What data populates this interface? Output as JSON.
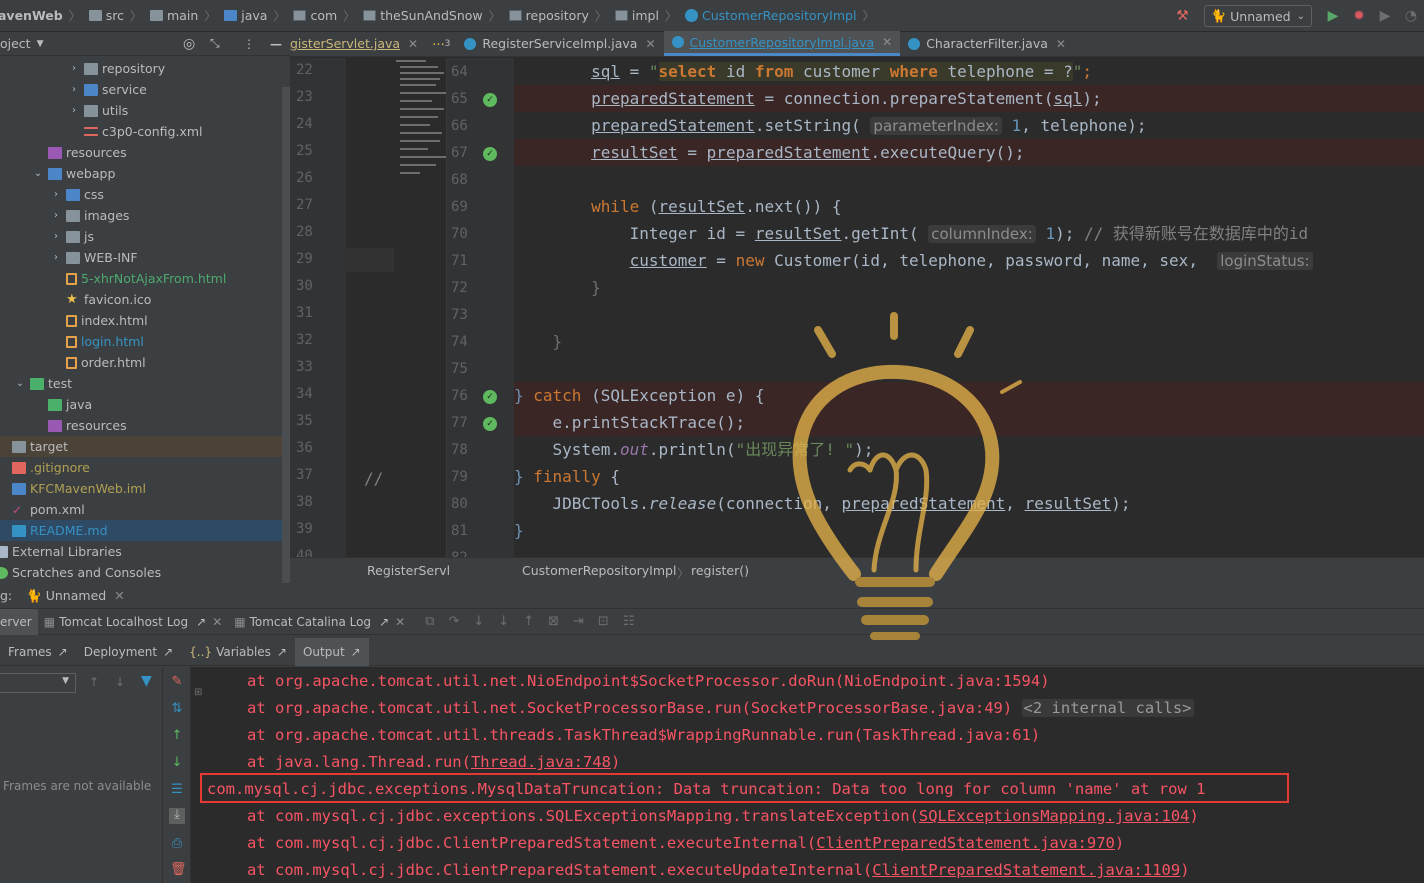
{
  "navbar": {
    "crumbs": [
      "avenWeb",
      "src",
      "main",
      "java",
      "com",
      "theSunAndSnow",
      "repository",
      "impl",
      "CustomerRepositoryImpl"
    ],
    "run_config": "Unnamed"
  },
  "project": {
    "header": "oject",
    "items": [
      {
        "label": "repository",
        "icon": "folder-icon"
      },
      {
        "label": "service",
        "icon": "folder-icon"
      },
      {
        "label": "utils",
        "icon": "folder-icon"
      },
      {
        "label": "c3p0-config.xml",
        "icon": "xml-file-icon"
      },
      {
        "label": "resources",
        "icon": "resources-folder-icon"
      },
      {
        "label": "webapp",
        "icon": "web-folder-icon"
      },
      {
        "label": "css",
        "icon": "folder-icon"
      },
      {
        "label": "images",
        "icon": "folder-icon"
      },
      {
        "label": "js",
        "icon": "folder-icon"
      },
      {
        "label": "WEB-INF",
        "icon": "folder-icon"
      },
      {
        "label": "5-xhrNotAjaxFrom.html",
        "icon": "html-file-icon"
      },
      {
        "label": "favicon.ico",
        "icon": "star-file-icon"
      },
      {
        "label": "index.html",
        "icon": "html-file-icon"
      },
      {
        "label": "login.html",
        "icon": "html-file-icon"
      },
      {
        "label": "order.html",
        "icon": "html-file-icon"
      },
      {
        "label": "test",
        "icon": "test-folder-icon"
      },
      {
        "label": "java",
        "icon": "test-source-folder-icon"
      },
      {
        "label": "resources",
        "icon": "resources-folder-icon"
      },
      {
        "label": "target",
        "icon": "folder-icon"
      },
      {
        "label": ".gitignore",
        "icon": "gitignore-file-icon"
      },
      {
        "label": "KFCMavenWeb.iml",
        "icon": "iml-file-icon"
      },
      {
        "label": "pom.xml",
        "icon": "maven-file-icon"
      },
      {
        "label": "README.md",
        "icon": "markdown-file-icon"
      },
      {
        "label": "External Libraries",
        "icon": "library-icon"
      },
      {
        "label": "Scratches and Consoles",
        "icon": "scratch-icon"
      }
    ]
  },
  "tabs": [
    {
      "label": "gisterServlet.java"
    },
    {
      "label": "RegisterServiceImpl.java"
    },
    {
      "label": "CustomerRepositoryImpl.java"
    },
    {
      "label": "CharacterFilter.java"
    }
  ],
  "tab_overflow": "3",
  "left_lines": [
    "22",
    "23",
    "24",
    "25",
    "26",
    "27",
    "28",
    "29",
    "30",
    "31",
    "32",
    "33",
    "34",
    "35",
    "36",
    "37",
    "38",
    "39",
    "40"
  ],
  "left_comment": "//",
  "right_lines": [
    "64",
    "65",
    "66",
    "67",
    "68",
    "69",
    "70",
    "71",
    "72",
    "73",
    "74",
    "75",
    "76",
    "77",
    "78",
    "79",
    "80",
    "81",
    "82"
  ],
  "code": {
    "l64": {
      "indent": "        ",
      "v1": "sql",
      "op": " = ",
      "q1": "\"",
      "s1": "select",
      "s2": " id ",
      "s3": "from",
      "s4": " customer ",
      "s5": "where",
      "s6": " telephone = ?",
      "q2": "\"",
      "end": ";"
    },
    "l65": {
      "indent": "        ",
      "v1": "preparedStatement",
      "mid": " = connection.prepareStatement(",
      "v2": "sql",
      "end": ");"
    },
    "l66": {
      "indent": "        ",
      "v1": "preparedStatement",
      "mid": ".setString( ",
      "hint": "parameterIndex:",
      "num": " 1",
      "end": ", telephone);"
    },
    "l67": {
      "indent": "        ",
      "v1": "resultSet",
      "mid": " = ",
      "v2": "preparedStatement",
      "end": ".executeQuery();"
    },
    "l69": {
      "indent": "        ",
      "kw": "while",
      "mid": " (",
      "v1": "resultSet",
      "end": ".next()) {"
    },
    "l70": {
      "indent": "            ",
      "pre": "Integer id = ",
      "v1": "resultSet",
      "mid": ".getInt( ",
      "hint": "columnIndex:",
      "num": " 1",
      "end": "); ",
      "cmt": "// 获得新账号在数据库中的id"
    },
    "l71": {
      "indent": "            ",
      "v1": "customer",
      "mid": " = ",
      "kw": "new",
      "end": " Customer(id, telephone, password, name, sex,  ",
      "hint": "loginStatus:"
    },
    "l72": {
      "indent": "        ",
      "text": "}"
    },
    "l74": {
      "indent": "    ",
      "text": "}"
    },
    "l76": {
      "indent": "",
      "b": "} ",
      "kw": "catch",
      "end": " (SQLException e) {"
    },
    "l77": {
      "indent": "    ",
      "text": "e.printStackTrace();"
    },
    "l78": {
      "indent": "    ",
      "pre": "System.",
      "field": "out",
      "mid": ".println(",
      "str": "\"出现异常了! \"",
      "end": ");"
    },
    "l79": {
      "indent": "",
      "b": "} ",
      "kw": "finally",
      "end": " {"
    },
    "l80": {
      "indent": "    ",
      "pre": "JDBCTools.",
      "ital": "release",
      "mid": "(connection, ",
      "v1": "preparedStatement",
      "sep": ", ",
      "v2": "resultSet",
      "end": ");"
    },
    "l81": {
      "indent": "",
      "text": "}"
    }
  },
  "editor_breadcrumb": {
    "left": "RegisterServl",
    "cls": "CustomerRepositoryImpl",
    "method": "register()"
  },
  "debug": {
    "title_prefix": "g:",
    "title": "Unnamed",
    "tabs": [
      "erver",
      "Tomcat Localhost Log",
      "Tomcat Catalina Log"
    ],
    "subtabs": [
      "Frames",
      "Deployment",
      "Variables",
      "Output"
    ],
    "frames_empty": "Frames are not available"
  },
  "console": [
    {
      "pre": "at org.apache.tomcat.util.net.NioEndpoint$SocketProcessor.doRun(NioEndpoint.java:1594)",
      "link": "",
      "post": "",
      "fold": ""
    },
    {
      "pre": "at org.apache.tomcat.util.net.SocketProcessorBase.run(SocketProcessorBase.java:49) ",
      "link": "",
      "post": "",
      "fold": "<2 internal calls>"
    },
    {
      "pre": "at org.apache.tomcat.util.threads.TaskThread$WrappingRunnable.run(TaskThread.java:61)",
      "link": "",
      "post": "",
      "fold": ""
    },
    {
      "pre": "at java.lang.Thread.run(",
      "link": "Thread.java:748",
      "post": ")",
      "fold": ""
    },
    {
      "pre": "com.mysql.cj.jdbc.exceptions.MysqlDataTruncation: Data truncation: Data too long for column 'name' at row 1",
      "link": "",
      "post": "",
      "fold": ""
    },
    {
      "pre": "at com.mysql.cj.jdbc.exceptions.SQLExceptionsMapping.translateException(",
      "link": "SQLExceptionsMapping.java:104",
      "post": ")",
      "fold": ""
    },
    {
      "pre": "at com.mysql.cj.jdbc.ClientPreparedStatement.executeInternal(",
      "link": "ClientPreparedStatement.java:970",
      "post": ")",
      "fold": ""
    },
    {
      "pre": "at com.mysql.cj.jdbc.ClientPreparedStatement.executeUpdateInternal(",
      "link": "ClientPreparedStatement.java:1109",
      "post": ")",
      "fold": ""
    }
  ],
  "colors": {
    "accent": "#3592c4",
    "error_text": "#f75464",
    "highlight_box": "#e53935",
    "check": "#5fb95f"
  }
}
